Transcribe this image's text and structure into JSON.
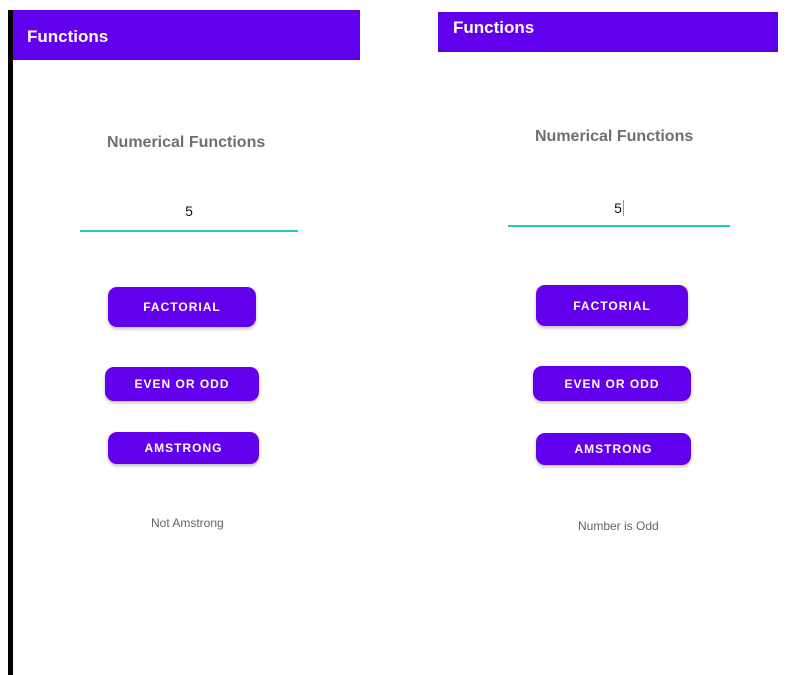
{
  "screens": [
    {
      "app_title": "Functions",
      "heading": "Numerical Functions",
      "input_value": "5",
      "buttons": {
        "factorial": "FACTORIAL",
        "even_or_odd": "EVEN OR ODD",
        "amstrong": "AMSTRONG"
      },
      "result_text": "Not Amstrong"
    },
    {
      "app_title": "Functions",
      "heading": "Numerical Functions",
      "input_value": "5",
      "buttons": {
        "factorial": "FACTORIAL",
        "even_or_odd": "EVEN OR ODD",
        "amstrong": "AMSTRONG"
      },
      "result_text": "Number is Odd"
    }
  ],
  "colors": {
    "primary": "#6200ee",
    "accent": "#26c6b9",
    "heading_text": "#6f6f6f",
    "result_text": "#666666"
  }
}
